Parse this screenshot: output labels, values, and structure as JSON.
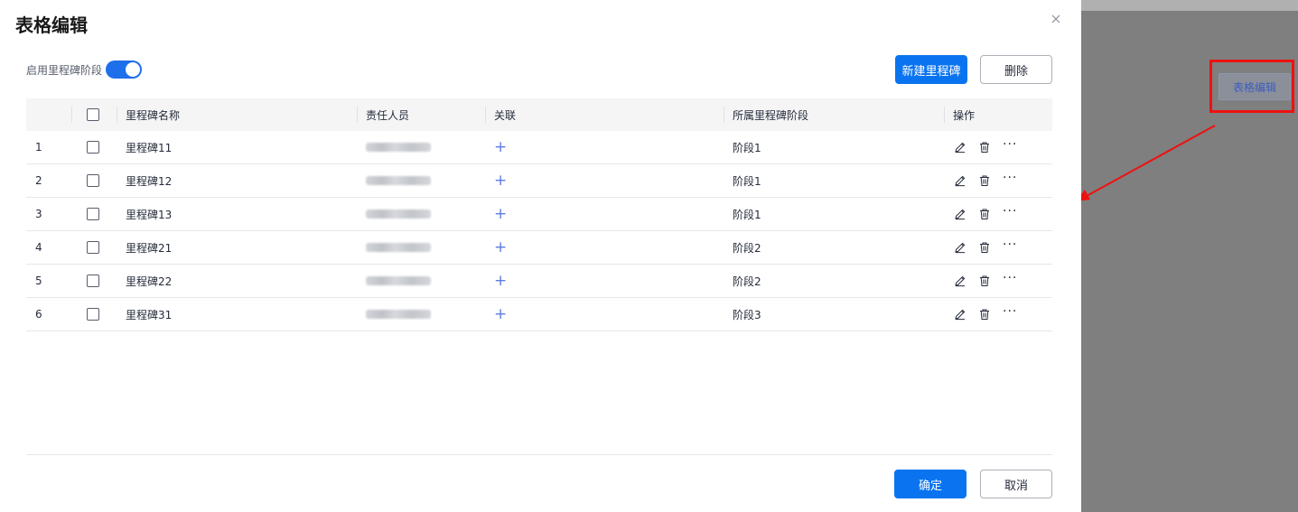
{
  "dialog": {
    "title": "表格编辑",
    "toggle_label": "启用里程碑阶段",
    "toggle_on": true,
    "new_button": "新建里程碑",
    "delete_button": "删除",
    "confirm_button": "确定",
    "cancel_button": "取消"
  },
  "table": {
    "headers": {
      "name": "里程碑名称",
      "owner": "责任人员",
      "relation": "关联",
      "stage": "所属里程碑阶段",
      "actions": "操作"
    },
    "rows": [
      {
        "index": "1",
        "name": "里程碑11",
        "relation": "+",
        "stage": "阶段1"
      },
      {
        "index": "2",
        "name": "里程碑12",
        "relation": "+",
        "stage": "阶段1"
      },
      {
        "index": "3",
        "name": "里程碑13",
        "relation": "+",
        "stage": "阶段1"
      },
      {
        "index": "4",
        "name": "里程碑21",
        "relation": "+",
        "stage": "阶段2"
      },
      {
        "index": "5",
        "name": "里程碑22",
        "relation": "+",
        "stage": "阶段2"
      },
      {
        "index": "6",
        "name": "里程碑31",
        "relation": "+",
        "stage": "阶段3"
      }
    ],
    "more_glyph": "···"
  },
  "background": {
    "button_label": "表格编辑"
  },
  "colors": {
    "primary": "#0a74f0",
    "toggle": "#1e6fea",
    "relation_plus": "#5e7ce0",
    "annotation_red": "#ee1111"
  },
  "icons": [
    "close-icon",
    "edit-icon",
    "trash-icon",
    "more-icon",
    "plus-icon",
    "annotation-arrow"
  ]
}
